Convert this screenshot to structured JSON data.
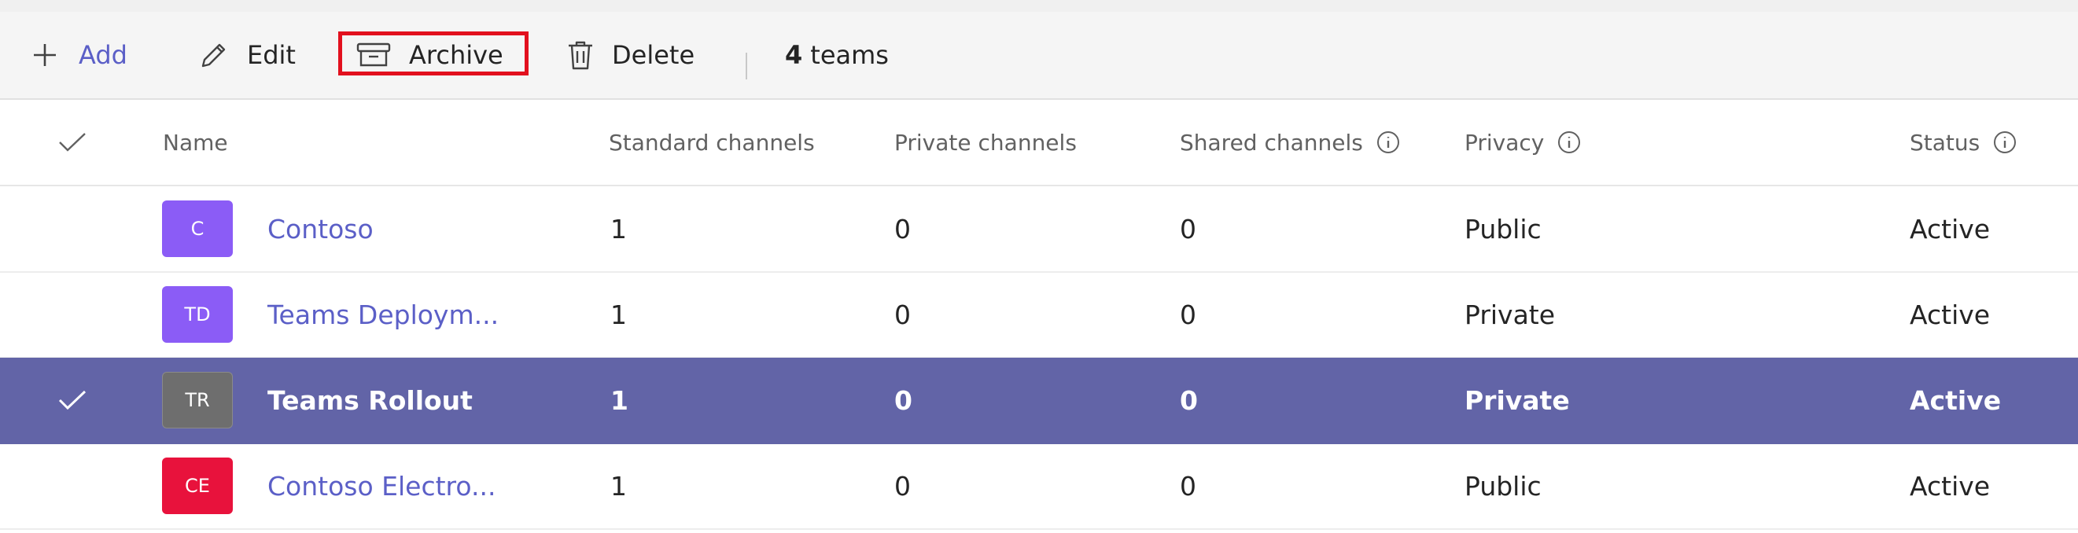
{
  "toolbar": {
    "add_label": "Add",
    "edit_label": "Edit",
    "archive_label": "Archive",
    "delete_label": "Delete",
    "count_number": "4",
    "count_label": "teams"
  },
  "columns": {
    "name": "Name",
    "standard": "Standard channels",
    "private": "Private channels",
    "shared": "Shared channels",
    "privacy": "Privacy",
    "status": "Status"
  },
  "rows": [
    {
      "initials": "C",
      "avatar_color": "#8b5cf6",
      "name": "Contoso",
      "standard": "1",
      "private": "0",
      "shared": "0",
      "privacy": "Public",
      "status": "Active",
      "selected": false
    },
    {
      "initials": "TD",
      "avatar_color": "#8b5cf6",
      "name": "Teams Deploym...",
      "standard": "1",
      "private": "0",
      "shared": "0",
      "privacy": "Private",
      "status": "Active",
      "selected": false
    },
    {
      "initials": "TR",
      "avatar_color": "#6e6e6e",
      "name": "Teams Rollout",
      "standard": "1",
      "private": "0",
      "shared": "0",
      "privacy": "Private",
      "status": "Active",
      "selected": true
    },
    {
      "initials": "CE",
      "avatar_color": "#e8123c",
      "name": "Contoso Electro...",
      "standard": "1",
      "private": "0",
      "shared": "0",
      "privacy": "Public",
      "status": "Active",
      "selected": false
    }
  ],
  "colors": {
    "accent": "#5b5fc7",
    "selected_row": "#6264a7",
    "highlight_box": "#e2101e"
  }
}
